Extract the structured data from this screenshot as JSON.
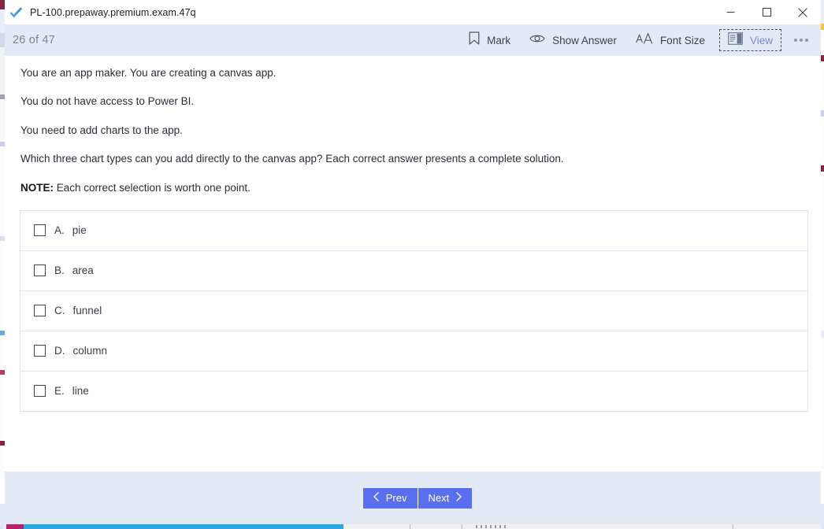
{
  "window": {
    "title": "PL-100.prepaway.premium.exam.47q",
    "app_icon": "blue-check-icon",
    "controls": {
      "minimize": "minimize-icon",
      "maximize": "maximize-icon",
      "close": "close-icon"
    }
  },
  "toolbar": {
    "counter": "26 of 47",
    "buttons": [
      {
        "label": "Mark",
        "icon": "bookmark-icon"
      },
      {
        "label": "Show Answer",
        "icon": "eye-icon"
      },
      {
        "label": "Font Size",
        "icon": "font-size-icon"
      },
      {
        "label": "View",
        "icon": "view-pane-icon",
        "focused": true
      }
    ],
    "more": "more-options-icon"
  },
  "question": {
    "lines": [
      "You are an app maker. You are creating a canvas app.",
      "You do not have access to Power BI.",
      "You need to add charts to the app.",
      "Which three chart types can you add directly to the canvas app? Each correct answer presents a complete solution."
    ],
    "note_prefix": "NOTE:",
    "note_text": " Each correct selection is worth one point."
  },
  "answers": [
    {
      "letter": "A.",
      "text": "pie",
      "checked": false
    },
    {
      "letter": "B.",
      "text": "area",
      "checked": false
    },
    {
      "letter": "C.",
      "text": "funnel",
      "checked": false
    },
    {
      "letter": "D.",
      "text": "column",
      "checked": false
    },
    {
      "letter": "E.",
      "text": "line",
      "checked": false
    }
  ],
  "footer": {
    "prev_label": "Prev",
    "next_label": "Next"
  },
  "colors": {
    "toolbar_bg": "#e4e9f6",
    "accent_button": "#5a6ef0",
    "focus_text": "#7b8bd4",
    "counter_text": "#7b8494"
  }
}
